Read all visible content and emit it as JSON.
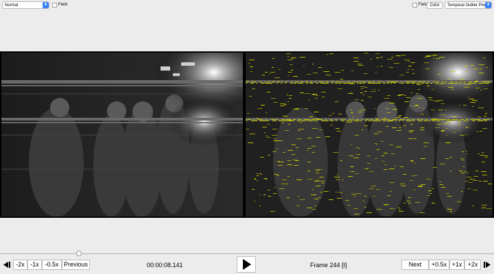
{
  "top_bar": {
    "left_view_mode": "Normal",
    "left_field_label": "Field",
    "right_field_label": "Field",
    "color_button_label": "Color",
    "right_filter_mode": "Temporal Outlier Pixels"
  },
  "player": {
    "timecode": "00:00:08.141",
    "frame_label": "Frame 244 [I]",
    "timeline_progress": 0.16
  },
  "controls": {
    "minus_2x": "-2x",
    "minus_1x": "-1x",
    "minus_half": "-0.5x",
    "previous": "Previous",
    "next": "Next",
    "plus_half": "+0.5x",
    "plus_1x": "+1x",
    "plus_2x": "+2x"
  },
  "icons": {
    "skip_start": "skip-to-start-icon",
    "play": "play-icon",
    "skip_end": "skip-to-end-icon",
    "dropdown": "dropdown-arrow-icon"
  },
  "colors": {
    "accent": "#3b82f6",
    "outlier_highlight": "#c8c800",
    "background": "#ececec"
  }
}
